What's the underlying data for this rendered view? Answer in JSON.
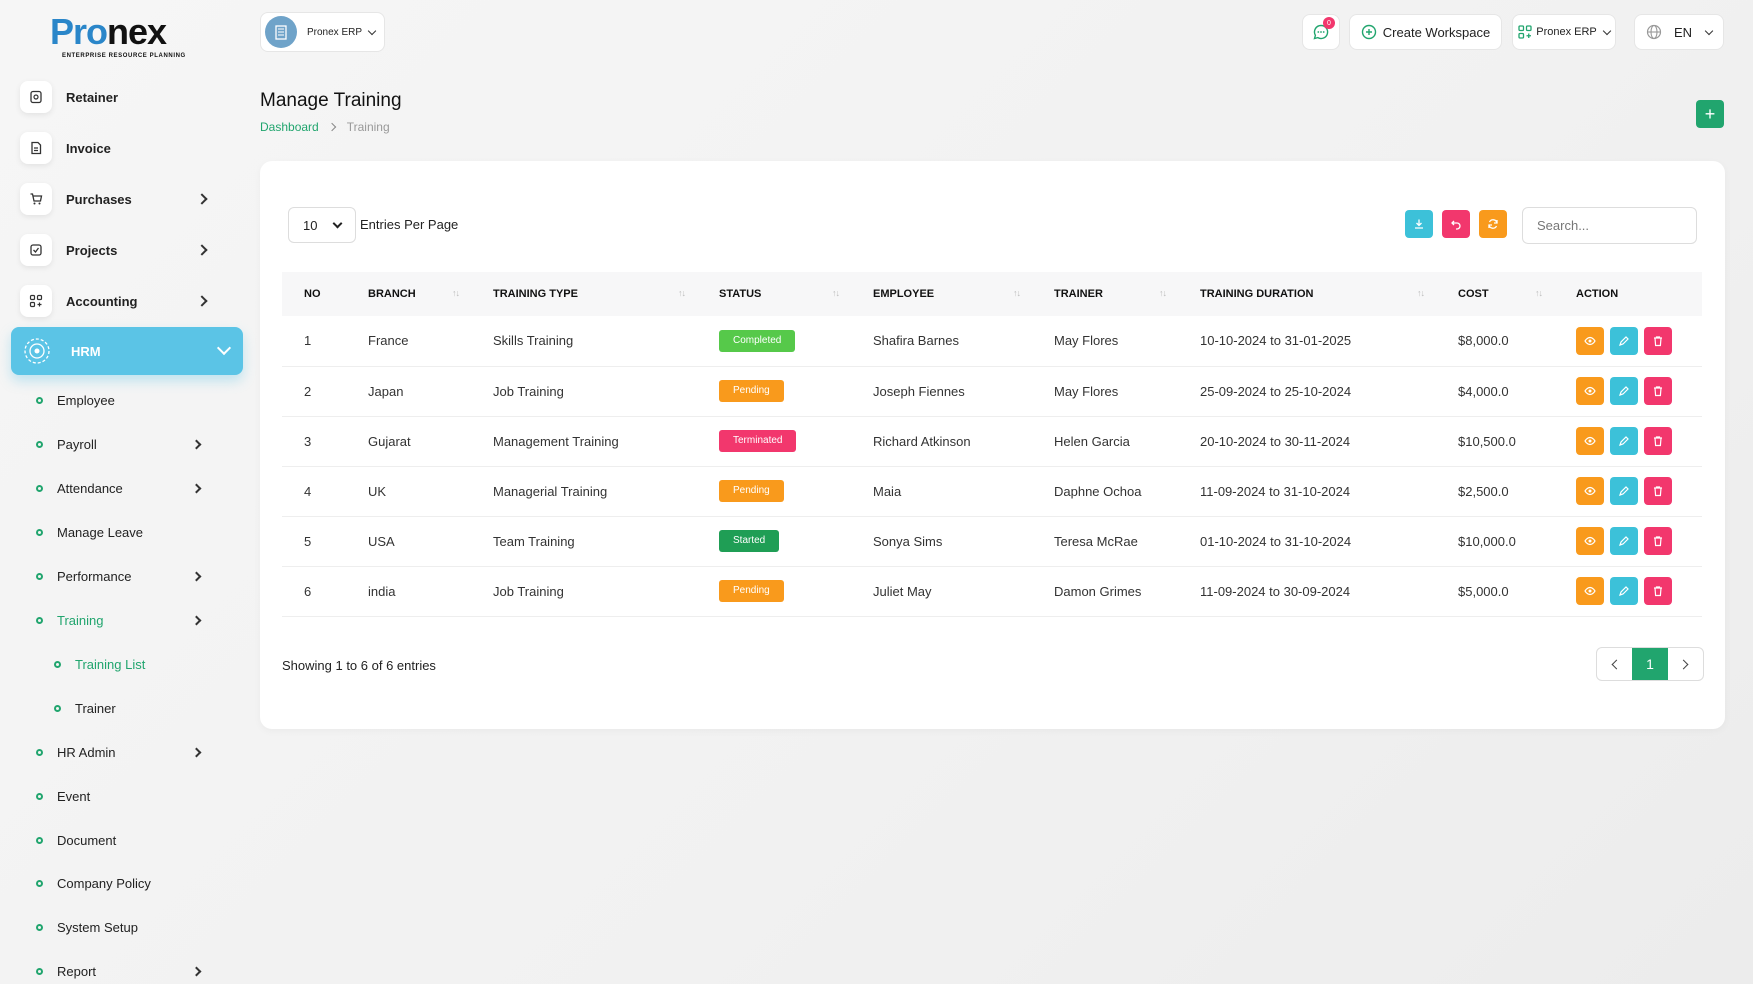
{
  "logo": {
    "brand_a": "Pro",
    "brand_b": "nex",
    "tagline": "ENTERPRISE RESOURCE PLANNING"
  },
  "sidebar": {
    "items": [
      {
        "label": "Retainer",
        "icon": "retainer-icon"
      },
      {
        "label": "Invoice",
        "icon": "invoice-icon"
      },
      {
        "label": "Purchases",
        "icon": "cart-icon"
      },
      {
        "label": "Projects",
        "icon": "projects-icon"
      },
      {
        "label": "Accounting",
        "icon": "accounting-icon"
      }
    ],
    "active": {
      "label": "HRM",
      "icon": "hrm-icon"
    },
    "sub_items": [
      {
        "label": "Employee"
      },
      {
        "label": "Payroll"
      },
      {
        "label": "Attendance"
      },
      {
        "label": "Manage Leave"
      },
      {
        "label": "Performance"
      },
      {
        "label": "Training"
      },
      {
        "label": "Training List"
      },
      {
        "label": "Trainer"
      },
      {
        "label": "HR Admin"
      },
      {
        "label": "Event"
      },
      {
        "label": "Document"
      },
      {
        "label": "Company Policy"
      },
      {
        "label": "System Setup"
      },
      {
        "label": "Report"
      }
    ]
  },
  "topbar": {
    "workspace": "Pronex ERP",
    "notification_count": "0",
    "create_workspace": "Create Workspace",
    "erp_menu": "Pronex ERP",
    "language": "EN"
  },
  "page": {
    "title": "Manage Training",
    "breadcrumb": [
      "Dashboard",
      "Training"
    ]
  },
  "table_controls": {
    "per_page": "10",
    "per_page_label": "Entries Per Page",
    "search_placeholder": "Search..."
  },
  "table": {
    "columns": [
      "NO",
      "BRANCH",
      "TRAINING TYPE",
      "STATUS",
      "EMPLOYEE",
      "TRAINER",
      "TRAINING DURATION",
      "COST",
      "ACTION"
    ],
    "rows": [
      {
        "no": "1",
        "branch": "France",
        "type": "Skills Training",
        "status": "Completed",
        "employee": "Shafira Barnes",
        "trainer": "May Flores",
        "duration": "10-10-2024 to 31-01-2025",
        "cost": "$8,000.0"
      },
      {
        "no": "2",
        "branch": "Japan",
        "type": "Job Training",
        "status": "Pending",
        "employee": "Joseph Fiennes",
        "trainer": "May Flores",
        "duration": "25-09-2024 to 25-10-2024",
        "cost": "$4,000.0"
      },
      {
        "no": "3",
        "branch": "Gujarat",
        "type": "Management Training",
        "status": "Terminated",
        "employee": "Richard Atkinson",
        "trainer": "Helen Garcia",
        "duration": "20-10-2024 to 30-11-2024",
        "cost": "$10,500.0"
      },
      {
        "no": "4",
        "branch": "UK",
        "type": "Managerial Training",
        "status": "Pending",
        "employee": "Maia",
        "trainer": "Daphne Ochoa",
        "duration": "11-09-2024 to 31-10-2024",
        "cost": "$2,500.0"
      },
      {
        "no": "5",
        "branch": "USA",
        "type": "Team Training",
        "status": "Started",
        "employee": "Sonya Sims",
        "trainer": "Teresa McRae",
        "duration": "01-10-2024 to 31-10-2024",
        "cost": "$10,000.0"
      },
      {
        "no": "6",
        "branch": "india",
        "type": "Job Training",
        "status": "Pending",
        "employee": "Juliet May",
        "trainer": "Damon Grimes",
        "duration": "11-09-2024 to 30-09-2024",
        "cost": "$5,000.0"
      }
    ]
  },
  "footer": {
    "showing": "Showing 1 to 6 of 6 entries",
    "current_page": "1"
  },
  "colors": {
    "accent": "#21a56e",
    "hrm": "#5bc4e6",
    "info": "#3cc1d9",
    "danger": "#f2376d",
    "warning": "#f99a1c",
    "completed": "#56c94a",
    "pending": "#f99a1c",
    "terminated": "#f2376d",
    "started": "#1f9e55"
  }
}
